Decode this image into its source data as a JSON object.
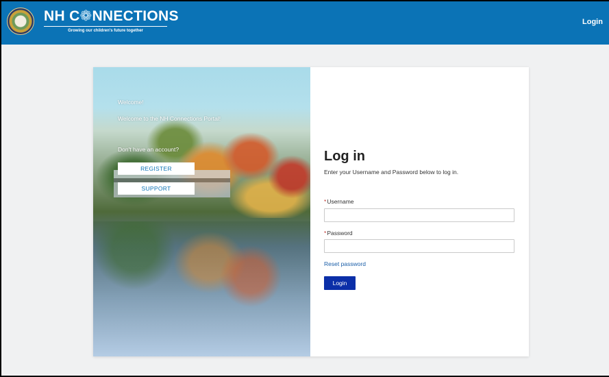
{
  "header": {
    "brand_prefix": "NH C",
    "brand_logo_letter": "❁",
    "brand_suffix": "NNECTIONS",
    "tagline": "Growing our children's future together",
    "login_link": "Login"
  },
  "side_panel": {
    "welcome": "Welcome!",
    "welcome_portal": "Welcome to the NH Connections Portal!",
    "no_account": "Don't have an account?",
    "register_label": "REGISTER",
    "support_label": "SUPPORT"
  },
  "login_form": {
    "title": "Log in",
    "subtitle": "Enter your Username and Password below to log in.",
    "required_marker": "*",
    "username_label": "Username",
    "username_value": "",
    "password_label": "Password",
    "password_value": "",
    "reset_link": "Reset password",
    "submit_label": "Login"
  },
  "colors": {
    "header_bg": "#0b73b6",
    "page_bg": "#f0f1f2",
    "primary_button": "#0b2fa8",
    "link": "#1a5ea8",
    "required": "#c23934"
  }
}
